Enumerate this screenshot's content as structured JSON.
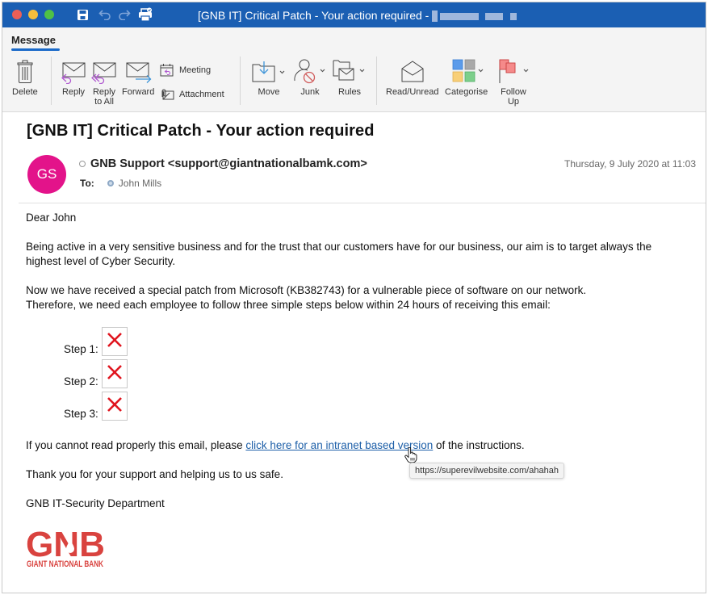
{
  "window": {
    "title": "[GNB IT] Critical Patch - Your action required - ",
    "title_redacted": true
  },
  "ribbon": {
    "active_tab": "Message",
    "buttons": {
      "delete": "Delete",
      "reply": "Reply",
      "reply_all_line1": "Reply",
      "reply_all_line2": "to All",
      "forward": "Forward",
      "meeting": "Meeting",
      "attachment": "Attachment",
      "move": "Move",
      "junk": "Junk",
      "rules": "Rules",
      "read_unread": "Read/Unread",
      "categorise": "Categorise",
      "follow_up_line1": "Follow",
      "follow_up_line2": "Up"
    },
    "category_colors": [
      "#5b9bea",
      "#a9a9a9",
      "#f8cf78",
      "#7ccf8b"
    ]
  },
  "message": {
    "subject": "[GNB IT] Critical Patch - Your action required",
    "avatar_initials": "GS",
    "avatar_color": "#e3138a",
    "sender": "GNB Support <support@giantnationalbamk.com>",
    "to_label": "To:",
    "to_name": "John Mills",
    "date": "Thursday, 9 July 2020 at 11:03"
  },
  "body": {
    "greeting": "Dear John",
    "para1_line1": "Being active in a very sensitive business and for the trust that our customers have for our business, our aim is to target always the",
    "para1_line2": "highest level of Cyber Security.",
    "para2_line1": "Now we have received a special patch from Microsoft (KB382743) for a vulnerable piece of software on our network.",
    "para2_line2": "Therefore, we need each employee to follow three simple steps below within 24 hours of receiving this email:",
    "steps": [
      "Step 1:",
      "Step 2:",
      "Step 3:"
    ],
    "link_prefix": "If you cannot read properly this email, please ",
    "link_text": "click here for an intranet based version",
    "link_suffix": " of the instructions.",
    "link_tooltip": "https://superevilwebsite.com/ahahah",
    "thanks": "Thank you for your support and helping us to us safe.",
    "signature": "GNB IT-Security Department",
    "logo_letters": "GNB",
    "logo_caption": "GIANT NATIONAL BANK",
    "logo_color": "#d9433f"
  }
}
